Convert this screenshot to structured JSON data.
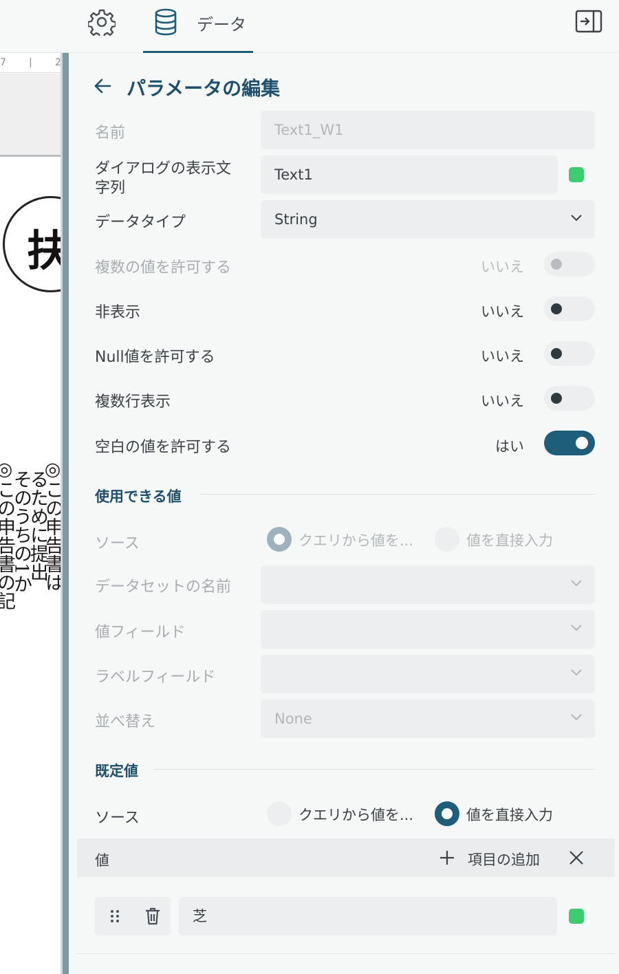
{
  "topbar": {
    "data_tab_label": "データ"
  },
  "document": {
    "ruler_marks": [
      "7",
      "|",
      "2"
    ],
    "circle_char": "扶",
    "vertical_lines": [
      "◎この申告書は",
      "るために提出",
      "そのうちの1か",
      "◎この申告書の記"
    ]
  },
  "panel": {
    "title": "パラメータの編集",
    "name": {
      "label": "名前",
      "value": "Text1_W1"
    },
    "prompt": {
      "label_line1": "ダイアログの表示文",
      "label_line2": "字列",
      "value": "Text1"
    },
    "data_type": {
      "label": "データタイプ",
      "value": "String"
    },
    "allow_multiple": {
      "label": "複数の値を許可する",
      "state": "いいえ",
      "on": false,
      "disabled": true
    },
    "hidden": {
      "label": "非表示",
      "state": "いいえ",
      "on": false
    },
    "allow_null": {
      "label": "Null値を許可する",
      "state": "いいえ",
      "on": false
    },
    "multiline": {
      "label": "複数行表示",
      "state": "いいえ",
      "on": false
    },
    "allow_blank": {
      "label": "空白の値を許可する",
      "state": "はい",
      "on": true
    },
    "available_values": {
      "section_title": "使用できる値",
      "source_label": "ソース",
      "option_query": "クエリから値を...",
      "option_direct": "値を直接入力",
      "selected": "query",
      "dataset_label": "データセットの名前",
      "value_field_label": "値フィールド",
      "label_field_label": "ラベルフィールド",
      "sort_label": "並べ替え",
      "sort_value": "None"
    },
    "default_values": {
      "section_title": "既定値",
      "source_label": "ソース",
      "option_query": "クエリから値を...",
      "option_direct": "値を直接入力",
      "selected": "direct",
      "values_label": "値",
      "add_item_label": "項目の追加",
      "items": [
        "芝"
      ]
    },
    "accent_color": "#1f5e7a",
    "indicator_color": "#3dcc6f"
  }
}
